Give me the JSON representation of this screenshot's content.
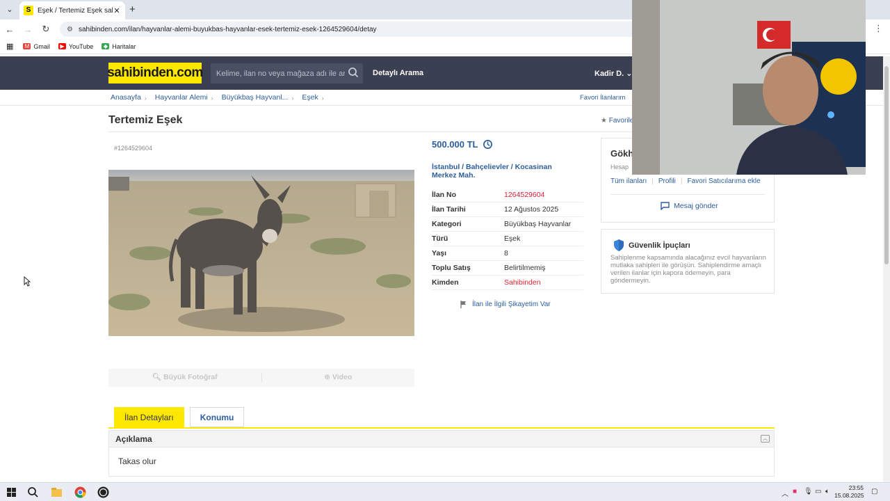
{
  "browser": {
    "tab_title": "Eşek / Tertemiz Eşek sahibinden.c",
    "tab_favicon": "S",
    "url": "sahibinden.com/ilan/hayvanlar-alemi-buyukbas-hayvanlar-esek-tertemiz-esek-1264529604/detay",
    "bookmarks": [
      "Gmail",
      "YouTube",
      "Haritalar"
    ]
  },
  "header": {
    "logo": "sahibinden.com",
    "search_placeholder": "Kelime, ilan no veya mağaza adı ile ara",
    "advanced_search": "Detaylı Arama",
    "user": "Kadir D."
  },
  "breadcrumb": [
    "Anasayfa",
    "Hayvanlar Alemi",
    "Büyükbaş Hayvanl...",
    "Eşek"
  ],
  "fav_links": "Favori İlanlarım",
  "listing": {
    "title": "Tertemiz Eşek",
    "favorites": "Favorile",
    "code": "#1264529604",
    "price": "500.000 TL",
    "location": "İstanbul  /  Bahçelievler  /  Kocasinan Merkez Mah.",
    "details": [
      {
        "key": "İlan No",
        "value": "1264529604",
        "red": true
      },
      {
        "key": "İlan Tarihi",
        "value": "12 Ağustos 2025",
        "red": false
      },
      {
        "key": "Kategori",
        "value": "Büyükbaş Hayvanlar",
        "red": false
      },
      {
        "key": "Türü",
        "value": "Eşek",
        "red": false
      },
      {
        "key": "Yaşı",
        "value": "8",
        "red": false
      },
      {
        "key": "Toplu Satış",
        "value": "Belirtilmemiş",
        "red": false
      },
      {
        "key": "Kimden",
        "value": "Sahibinden",
        "red": true
      }
    ],
    "report": "İlan ile İlgili Şikayetim Var",
    "photo_big": "Büyük Fotoğraf",
    "photo_video": "Video"
  },
  "seller": {
    "name": "Gökha",
    "since": "Hesap",
    "links": [
      "Tüm ilanları",
      "Profili",
      "Favori Satıcılarıma ekle"
    ],
    "message": "Mesaj gönder"
  },
  "safety": {
    "title": "Güvenlik İpuçları",
    "text": "Sahiplenme kapsamında alacağınız evcil hayvanların mutlaka sahipleri ile görüşün. Sahiplendirme amaçlı verilen ilanlar için kapora ödemeyin, para göndermeyin."
  },
  "tabs": [
    "İlan Detayları",
    "Konumu"
  ],
  "description": {
    "heading": "Açıklama",
    "body": "Takas olur"
  },
  "taskbar": {
    "time": "23:55",
    "date": "15.08.2025"
  },
  "colors": {
    "brand_yellow": "#ffe800",
    "header_bg": "#3a3f51",
    "link_blue": "#2c5d9c",
    "accent_red": "#d92031"
  }
}
